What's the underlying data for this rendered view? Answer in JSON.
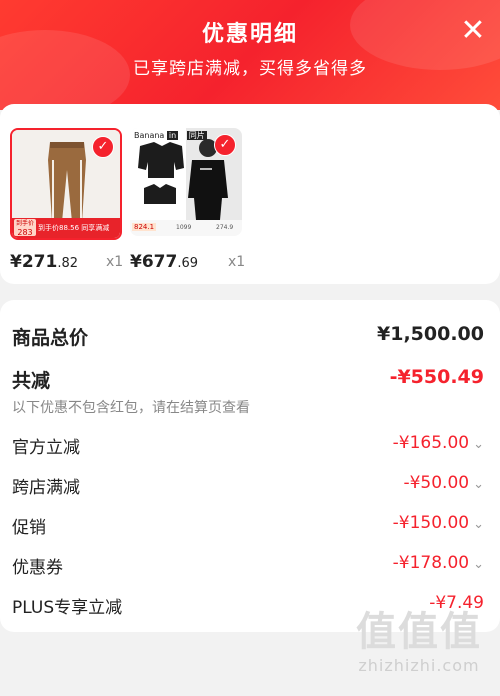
{
  "header": {
    "title": "优惠明细",
    "subtitle": "已享跨店满减，买得多省得多",
    "close_icon": "close-icon",
    "accent_color": "#f5222d"
  },
  "products": [
    {
      "price_main": "¥271",
      "price_cents": ".82",
      "quantity": "x1",
      "selected": true,
      "thumb_badge": "到手价",
      "thumb_price": "283",
      "thumb_tag": "到手价88.56 同享满减"
    },
    {
      "price_main": "¥677",
      "price_cents": ".69",
      "quantity": "x1",
      "selected": true,
      "thumb_brand": "Banana",
      "thumb_brand2": "in",
      "thumb_tag2": "同片",
      "thumb_price": "824.1",
      "thumb_p2": "1099",
      "thumb_p3": "274.9"
    }
  ],
  "summary": {
    "total_label": "商品总价",
    "total_value": "¥1,500.00",
    "discount_label": "共减",
    "discount_value": "-¥550.49",
    "note": "以下优惠不包含红包，请在结算页查看",
    "items": [
      {
        "label": "官方立减",
        "value": "-¥165.00",
        "chevron": true
      },
      {
        "label": "跨店满减",
        "value": "-¥50.00",
        "chevron": true
      },
      {
        "label": "促销",
        "value": "-¥150.00",
        "chevron": true
      },
      {
        "label": "优惠券",
        "value": "-¥178.00",
        "chevron": true
      },
      {
        "label": "PLUS专享立减",
        "value": "-¥7.49",
        "chevron": false
      }
    ]
  },
  "watermark": {
    "chars": "值值值",
    "url": "zhizhizhi.com"
  }
}
